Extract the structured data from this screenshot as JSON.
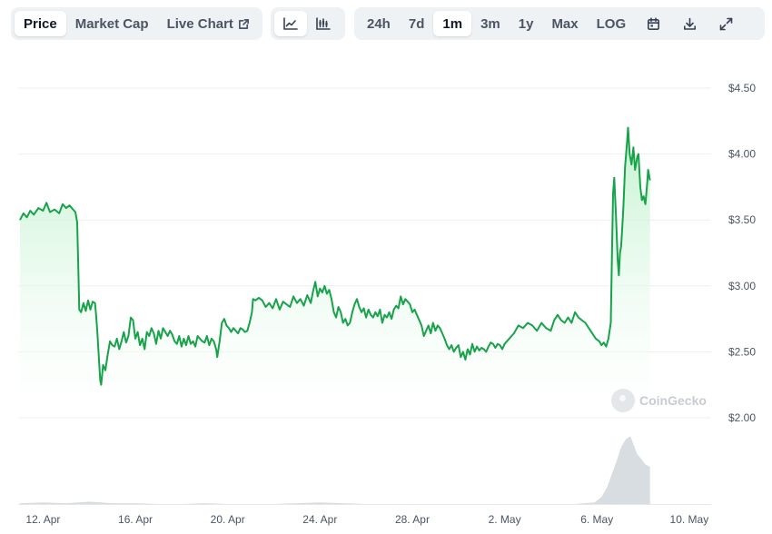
{
  "toolbar": {
    "type_tabs": [
      {
        "label": "Price",
        "active": true
      },
      {
        "label": "Market Cap",
        "active": false
      },
      {
        "label": "Live Chart",
        "active": false
      }
    ],
    "view_icons": [
      "line-chart-icon",
      "candlestick-chart-icon"
    ],
    "ranges": [
      {
        "label": "24h",
        "active": false
      },
      {
        "label": "7d",
        "active": false
      },
      {
        "label": "1m",
        "active": true
      },
      {
        "label": "3m",
        "active": false
      },
      {
        "label": "1y",
        "active": false
      },
      {
        "label": "Max",
        "active": false
      },
      {
        "label": "LOG",
        "active": false
      }
    ],
    "action_icons": [
      "calendar-icon",
      "download-icon",
      "expand-icon"
    ]
  },
  "watermark": "CoinGecko",
  "colors": {
    "line": "#16a34a",
    "fill_top": "#bbf0c9",
    "volume": "#d8dde2",
    "grid": "#eceff2",
    "axis_text": "#4b5563",
    "active_tab_bg": "#ffffff",
    "group_bg": "#eff2f5"
  },
  "chart_data": {
    "type": "area",
    "title": "",
    "xlabel": "",
    "ylabel": "",
    "ylim": [
      2.0,
      4.5
    ],
    "y_ticks": [
      "$4.50",
      "$4.00",
      "$3.50",
      "$3.00",
      "$2.50",
      "$2.00"
    ],
    "y_tick_values": [
      4.5,
      4.0,
      3.5,
      3.0,
      2.5,
      2.0
    ],
    "x_ticks": [
      "12. Apr",
      "16. Apr",
      "20. Apr",
      "24. Apr",
      "28. Apr",
      "2. May",
      "6. May",
      "10. May"
    ],
    "x_tick_days": [
      1,
      5,
      9,
      13,
      17,
      21,
      25,
      29
    ],
    "xlim_days": [
      0,
      29.95
    ],
    "series": [
      {
        "values": [
          [
            0.0,
            3.5
          ],
          [
            0.15,
            3.55
          ],
          [
            0.3,
            3.52
          ],
          [
            0.45,
            3.57
          ],
          [
            0.6,
            3.54
          ],
          [
            0.8,
            3.59
          ],
          [
            1.0,
            3.57
          ],
          [
            1.15,
            3.63
          ],
          [
            1.3,
            3.56
          ],
          [
            1.5,
            3.58
          ],
          [
            1.7,
            3.55
          ],
          [
            1.85,
            3.62
          ],
          [
            2.0,
            3.59
          ],
          [
            2.15,
            3.61
          ],
          [
            2.3,
            3.58
          ],
          [
            2.4,
            3.56
          ],
          [
            2.48,
            3.48
          ],
          [
            2.52,
            3.2
          ],
          [
            2.57,
            2.82
          ],
          [
            2.65,
            2.8
          ],
          [
            2.75,
            2.87
          ],
          [
            2.85,
            2.81
          ],
          [
            2.95,
            2.89
          ],
          [
            3.05,
            2.82
          ],
          [
            3.15,
            2.88
          ],
          [
            3.25,
            2.87
          ],
          [
            3.3,
            2.78
          ],
          [
            3.35,
            2.66
          ],
          [
            3.42,
            2.45
          ],
          [
            3.48,
            2.28
          ],
          [
            3.52,
            2.25
          ],
          [
            3.6,
            2.4
          ],
          [
            3.7,
            2.36
          ],
          [
            3.8,
            2.48
          ],
          [
            3.9,
            2.58
          ],
          [
            4.0,
            2.55
          ],
          [
            4.1,
            2.54
          ],
          [
            4.2,
            2.6
          ],
          [
            4.3,
            2.52
          ],
          [
            4.4,
            2.58
          ],
          [
            4.5,
            2.65
          ],
          [
            4.6,
            2.57
          ],
          [
            4.7,
            2.62
          ],
          [
            4.8,
            2.76
          ],
          [
            4.9,
            2.74
          ],
          [
            5.0,
            2.6
          ],
          [
            5.1,
            2.65
          ],
          [
            5.2,
            2.55
          ],
          [
            5.3,
            2.6
          ],
          [
            5.4,
            2.52
          ],
          [
            5.5,
            2.65
          ],
          [
            5.6,
            2.62
          ],
          [
            5.7,
            2.68
          ],
          [
            5.8,
            2.64
          ],
          [
            5.9,
            2.56
          ],
          [
            6.0,
            2.66
          ],
          [
            6.1,
            2.6
          ],
          [
            6.2,
            2.68
          ],
          [
            6.3,
            2.65
          ],
          [
            6.4,
            2.62
          ],
          [
            6.5,
            2.66
          ],
          [
            6.6,
            2.63
          ],
          [
            6.7,
            2.58
          ],
          [
            6.8,
            2.56
          ],
          [
            6.9,
            2.62
          ],
          [
            7.0,
            2.54
          ],
          [
            7.1,
            2.6
          ],
          [
            7.2,
            2.55
          ],
          [
            7.3,
            2.62
          ],
          [
            7.4,
            2.56
          ],
          [
            7.5,
            2.58
          ],
          [
            7.6,
            2.54
          ],
          [
            7.7,
            2.62
          ],
          [
            7.8,
            2.6
          ],
          [
            7.9,
            2.58
          ],
          [
            8.0,
            2.57
          ],
          [
            8.1,
            2.62
          ],
          [
            8.2,
            2.55
          ],
          [
            8.3,
            2.6
          ],
          [
            8.4,
            2.58
          ],
          [
            8.5,
            2.52
          ],
          [
            8.55,
            2.46
          ],
          [
            8.65,
            2.58
          ],
          [
            8.75,
            2.72
          ],
          [
            8.85,
            2.75
          ],
          [
            8.95,
            2.7
          ],
          [
            9.05,
            2.68
          ],
          [
            9.15,
            2.65
          ],
          [
            9.25,
            2.68
          ],
          [
            9.35,
            2.66
          ],
          [
            9.45,
            2.64
          ],
          [
            9.55,
            2.68
          ],
          [
            9.65,
            2.67
          ],
          [
            9.75,
            2.65
          ],
          [
            9.85,
            2.66
          ],
          [
            9.95,
            2.72
          ],
          [
            10.05,
            2.8
          ],
          [
            10.1,
            2.9
          ],
          [
            10.2,
            2.89
          ],
          [
            10.35,
            2.91
          ],
          [
            10.5,
            2.89
          ],
          [
            10.65,
            2.84
          ],
          [
            10.8,
            2.87
          ],
          [
            10.95,
            2.83
          ],
          [
            11.1,
            2.9
          ],
          [
            11.25,
            2.82
          ],
          [
            11.4,
            2.88
          ],
          [
            11.55,
            2.86
          ],
          [
            11.7,
            2.84
          ],
          [
            11.85,
            2.92
          ],
          [
            12.0,
            2.87
          ],
          [
            12.15,
            2.9
          ],
          [
            12.3,
            2.85
          ],
          [
            12.45,
            2.93
          ],
          [
            12.6,
            2.87
          ],
          [
            12.7,
            2.96
          ],
          [
            12.8,
            3.03
          ],
          [
            12.9,
            2.92
          ],
          [
            13.0,
            2.98
          ],
          [
            13.1,
            2.95
          ],
          [
            13.2,
            3.0
          ],
          [
            13.3,
            2.94
          ],
          [
            13.4,
            2.97
          ],
          [
            13.5,
            2.9
          ],
          [
            13.6,
            2.8
          ],
          [
            13.7,
            2.76
          ],
          [
            13.8,
            2.84
          ],
          [
            13.9,
            2.8
          ],
          [
            14.0,
            2.72
          ],
          [
            14.1,
            2.75
          ],
          [
            14.2,
            2.7
          ],
          [
            14.3,
            2.72
          ],
          [
            14.4,
            2.8
          ],
          [
            14.5,
            2.86
          ],
          [
            14.6,
            2.9
          ],
          [
            14.7,
            2.84
          ],
          [
            14.8,
            2.8
          ],
          [
            14.9,
            2.83
          ],
          [
            15.0,
            2.76
          ],
          [
            15.1,
            2.82
          ],
          [
            15.2,
            2.78
          ],
          [
            15.3,
            2.76
          ],
          [
            15.4,
            2.8
          ],
          [
            15.5,
            2.77
          ],
          [
            15.6,
            2.82
          ],
          [
            15.7,
            2.72
          ],
          [
            15.8,
            2.78
          ],
          [
            15.9,
            2.76
          ],
          [
            16.0,
            2.8
          ],
          [
            16.1,
            2.75
          ],
          [
            16.2,
            2.82
          ],
          [
            16.3,
            2.85
          ],
          [
            16.4,
            2.83
          ],
          [
            16.5,
            2.92
          ],
          [
            16.6,
            2.86
          ],
          [
            16.7,
            2.9
          ],
          [
            16.8,
            2.88
          ],
          [
            16.9,
            2.86
          ],
          [
            17.0,
            2.8
          ],
          [
            17.1,
            2.82
          ],
          [
            17.2,
            2.78
          ],
          [
            17.3,
            2.74
          ],
          [
            17.4,
            2.7
          ],
          [
            17.5,
            2.62
          ],
          [
            17.6,
            2.66
          ],
          [
            17.7,
            2.7
          ],
          [
            17.8,
            2.64
          ],
          [
            17.9,
            2.72
          ],
          [
            18.0,
            2.66
          ],
          [
            18.1,
            2.7
          ],
          [
            18.2,
            2.68
          ],
          [
            18.3,
            2.64
          ],
          [
            18.4,
            2.6
          ],
          [
            18.5,
            2.55
          ],
          [
            18.6,
            2.52
          ],
          [
            18.7,
            2.55
          ],
          [
            18.8,
            2.5
          ],
          [
            18.9,
            2.53
          ],
          [
            19.0,
            2.55
          ],
          [
            19.1,
            2.46
          ],
          [
            19.2,
            2.5
          ],
          [
            19.3,
            2.44
          ],
          [
            19.4,
            2.52
          ],
          [
            19.5,
            2.48
          ],
          [
            19.6,
            2.56
          ],
          [
            19.7,
            2.5
          ],
          [
            19.8,
            2.54
          ],
          [
            19.9,
            2.51
          ],
          [
            20.0,
            2.53
          ],
          [
            20.1,
            2.52
          ],
          [
            20.2,
            2.5
          ],
          [
            20.3,
            2.54
          ],
          [
            20.4,
            2.57
          ],
          [
            20.5,
            2.56
          ],
          [
            20.6,
            2.53
          ],
          [
            20.7,
            2.56
          ],
          [
            20.8,
            2.55
          ],
          [
            20.9,
            2.52
          ],
          [
            21.0,
            2.56
          ],
          [
            21.2,
            2.6
          ],
          [
            21.4,
            2.64
          ],
          [
            21.6,
            2.7
          ],
          [
            21.8,
            2.68
          ],
          [
            22.0,
            2.72
          ],
          [
            22.2,
            2.7
          ],
          [
            22.4,
            2.66
          ],
          [
            22.6,
            2.72
          ],
          [
            22.8,
            2.68
          ],
          [
            23.0,
            2.66
          ],
          [
            23.15,
            2.74
          ],
          [
            23.3,
            2.78
          ],
          [
            23.45,
            2.74
          ],
          [
            23.6,
            2.72
          ],
          [
            23.75,
            2.76
          ],
          [
            23.9,
            2.72
          ],
          [
            24.05,
            2.8
          ],
          [
            24.2,
            2.76
          ],
          [
            24.35,
            2.74
          ],
          [
            24.5,
            2.72
          ],
          [
            24.65,
            2.68
          ],
          [
            24.8,
            2.64
          ],
          [
            24.95,
            2.6
          ],
          [
            25.1,
            2.58
          ],
          [
            25.2,
            2.55
          ],
          [
            25.3,
            2.57
          ],
          [
            25.4,
            2.54
          ],
          [
            25.5,
            2.6
          ],
          [
            25.6,
            2.72
          ],
          [
            25.65,
            3.2
          ],
          [
            25.7,
            3.7
          ],
          [
            25.75,
            3.82
          ],
          [
            25.82,
            3.55
          ],
          [
            25.9,
            3.2
          ],
          [
            25.95,
            3.08
          ],
          [
            26.0,
            3.25
          ],
          [
            26.05,
            3.3
          ],
          [
            26.1,
            3.45
          ],
          [
            26.15,
            3.6
          ],
          [
            26.22,
            3.9
          ],
          [
            26.3,
            4.08
          ],
          [
            26.35,
            4.2
          ],
          [
            26.42,
            4.0
          ],
          [
            26.5,
            3.92
          ],
          [
            26.58,
            4.05
          ],
          [
            26.65,
            3.88
          ],
          [
            26.75,
            3.98
          ],
          [
            26.8,
            4.0
          ],
          [
            26.88,
            3.75
          ],
          [
            26.95,
            3.65
          ],
          [
            27.02,
            3.68
          ],
          [
            27.1,
            3.62
          ],
          [
            27.18,
            3.78
          ],
          [
            27.22,
            3.88
          ],
          [
            27.3,
            3.8
          ]
        ]
      }
    ],
    "volume": {
      "ylim": [
        0,
        100
      ],
      "values": [
        [
          0,
          1
        ],
        [
          1,
          2
        ],
        [
          2,
          1
        ],
        [
          3,
          3
        ],
        [
          4,
          1
        ],
        [
          5,
          1
        ],
        [
          6,
          0
        ],
        [
          7,
          0
        ],
        [
          8,
          1
        ],
        [
          9,
          0
        ],
        [
          10,
          0
        ],
        [
          11,
          0
        ],
        [
          12,
          1
        ],
        [
          13,
          2
        ],
        [
          14,
          1
        ],
        [
          15,
          0
        ],
        [
          16,
          0
        ],
        [
          17,
          0
        ],
        [
          18,
          0
        ],
        [
          19,
          0
        ],
        [
          20,
          0
        ],
        [
          21,
          0
        ],
        [
          22,
          0
        ],
        [
          23,
          0
        ],
        [
          24,
          0
        ],
        [
          24.9,
          2
        ],
        [
          25.2,
          9
        ],
        [
          25.45,
          22
        ],
        [
          25.65,
          38
        ],
        [
          25.85,
          54
        ],
        [
          26.05,
          72
        ],
        [
          26.25,
          82
        ],
        [
          26.45,
          86
        ],
        [
          26.6,
          74
        ],
        [
          26.75,
          63
        ],
        [
          26.95,
          56
        ],
        [
          27.1,
          50
        ],
        [
          27.25,
          48
        ],
        [
          27.3,
          47
        ]
      ]
    }
  }
}
